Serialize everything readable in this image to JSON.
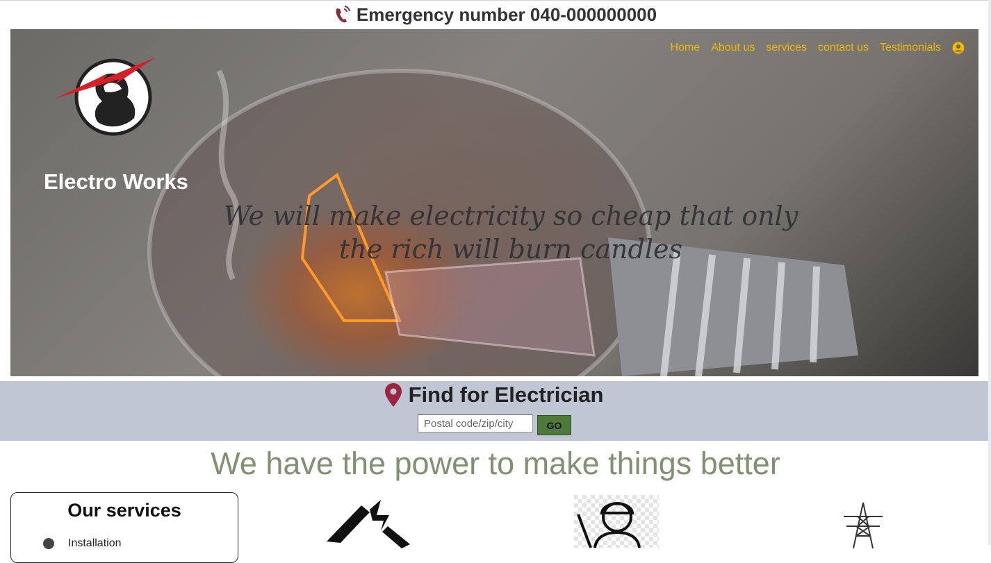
{
  "emergency": {
    "text": "Emergency number 040-000000000",
    "icon": "phone-icon",
    "icon_color": "#8a2b3b"
  },
  "brand": {
    "name": "Electro Works",
    "logo": "electrician-logo"
  },
  "nav": {
    "items": [
      "Home",
      "About us",
      "services",
      "contact us",
      "Testimonials"
    ],
    "user_icon": "user-circle-icon",
    "color": "#f0b800"
  },
  "hero": {
    "quote": "We will make electricity so cheap that only the rich will burn candles"
  },
  "finder": {
    "title": "Find for Electrician",
    "icon": "map-pin-icon",
    "input_placeholder": "Postal code/zip/city",
    "button_label": "GO",
    "background": "#c0c6d3"
  },
  "tagline": "We have the power to make things better",
  "services_box": {
    "title": "Our services",
    "items": [
      "Installation"
    ]
  },
  "feature_icons": [
    "electrical-house-icon",
    "electrician-worker-icon",
    "power-tower-icon"
  ]
}
